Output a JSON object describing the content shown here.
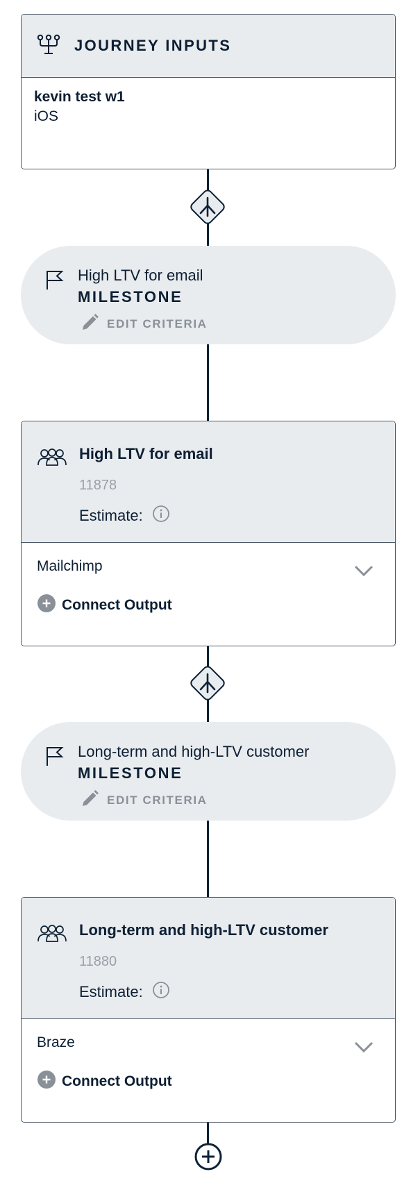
{
  "journey_inputs": {
    "title": "JOURNEY INPUTS",
    "name": "kevin test w1",
    "platform": "iOS"
  },
  "steps": [
    {
      "milestone": {
        "name": "High LTV for email",
        "kind": "MILESTONE",
        "edit_label": "EDIT CRITERIA"
      },
      "audience": {
        "name": "High LTV for email",
        "count": "11878",
        "estimate_label": "Estimate:",
        "destination": "Mailchimp",
        "connect_label": "Connect Output"
      }
    },
    {
      "milestone": {
        "name": "Long-term and high-LTV customer",
        "kind": "MILESTONE",
        "edit_label": "EDIT CRITERIA"
      },
      "audience": {
        "name": "Long-term and high-LTV customer",
        "count": "11880",
        "estimate_label": "Estimate:",
        "destination": "Braze",
        "connect_label": "Connect Output"
      }
    }
  ],
  "icons": {
    "inputs": "journey-inputs-icon",
    "split": "split-icon",
    "milestone": "flag-icon",
    "edit": "pencil-icon",
    "audience": "people-group-icon",
    "estimate_info": "info-icon",
    "dropdown": "chevron-down-icon",
    "connect": "plus-circle-icon",
    "add_step": "add-step-icon"
  },
  "colors": {
    "navy": "#0d1f33",
    "panel_gray": "#e9ecef",
    "muted_gray": "#8a9097",
    "border": "#4a5664"
  }
}
